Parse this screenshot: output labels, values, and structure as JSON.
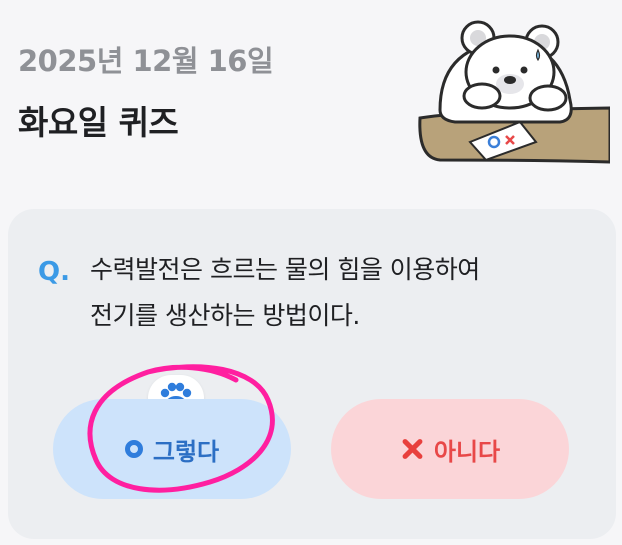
{
  "header": {
    "date": "2025년 12월 16일",
    "title": "화요일 퀴즈"
  },
  "quiz": {
    "q_label": "Q.",
    "question_line1": "수력발전은 흐르는 물의 힘을 이용하여",
    "question_line2": "전기를 생산하는 방법이다.",
    "answers": [
      {
        "label": "그렇다",
        "icon": "o-circle-icon",
        "color": "#2f7ddc"
      },
      {
        "label": "아니다",
        "icon": "x-cross-icon",
        "color": "#e8403d"
      }
    ]
  },
  "mascot_card_marks": "OX",
  "colors": {
    "accent": "#3b9ae6",
    "yes_bg": "#cde3fb",
    "no_bg": "#fbd5d8",
    "highlight": "#ff1fa0"
  }
}
